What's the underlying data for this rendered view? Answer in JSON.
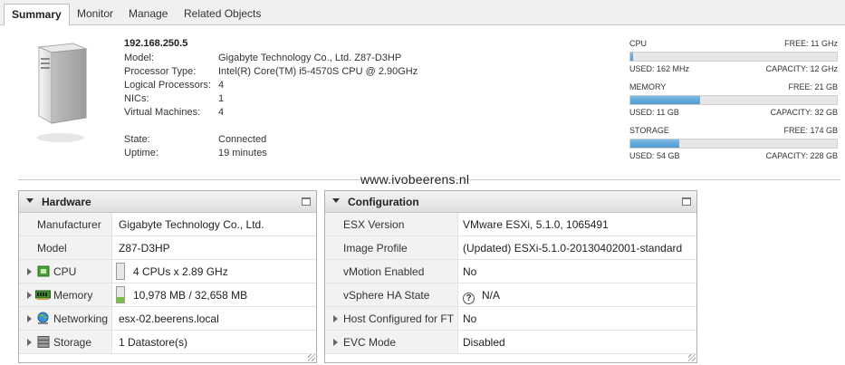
{
  "tabs": [
    {
      "label": "Summary",
      "active": true
    },
    {
      "label": "Monitor",
      "active": false
    },
    {
      "label": "Manage",
      "active": false
    },
    {
      "label": "Related Objects",
      "active": false
    }
  ],
  "host": {
    "name": "192.168.250.5",
    "fields": [
      {
        "label": "Model:",
        "value": "Gigabyte Technology Co., Ltd. Z87-D3HP"
      },
      {
        "label": "Processor Type:",
        "value": "Intel(R) Core(TM) i5-4570S CPU @ 2.90GHz"
      },
      {
        "label": "Logical Processors:",
        "value": "4"
      },
      {
        "label": "NICs:",
        "value": "1"
      },
      {
        "label": "Virtual Machines:",
        "value": "4"
      }
    ],
    "status": [
      {
        "label": "State:",
        "value": "Connected"
      },
      {
        "label": "Uptime:",
        "value": "19 minutes"
      }
    ]
  },
  "resources": [
    {
      "name": "CPU",
      "free": "FREE: 11 GHz",
      "used": "USED: 162 MHz",
      "capacity": "CAPACITY: 12 GHz",
      "fraction": 0.0135
    },
    {
      "name": "MEMORY",
      "free": "FREE: 21 GB",
      "used": "USED: 11 GB",
      "capacity": "CAPACITY: 32 GB",
      "fraction": 0.336
    },
    {
      "name": "STORAGE",
      "free": "FREE: 174 GB",
      "used": "USED: 54 GB",
      "capacity": "CAPACITY: 228 GB",
      "fraction": 0.237
    }
  ],
  "watermark": "www.ivobeerens.nl",
  "hardware": {
    "title": "Hardware",
    "rows": [
      {
        "label": "Manufacturer",
        "value": "Gigabyte Technology Co., Ltd."
      },
      {
        "label": "Model",
        "value": "Z87-D3HP"
      },
      {
        "label": "CPU",
        "value": "4 CPUs x 2.89 GHz",
        "icon": "cpu-icon",
        "usage": 0.0
      },
      {
        "label": "Memory",
        "value": "10,978 MB / 32,658 MB",
        "icon": "memory-icon",
        "usage": 0.336
      },
      {
        "label": "Networking",
        "value": "esx-02.beerens.local",
        "icon": "network-globe-icon"
      },
      {
        "label": "Storage",
        "value": "1 Datastore(s)",
        "icon": "storage-disk-icon"
      }
    ]
  },
  "configuration": {
    "title": "Configuration",
    "rows": [
      {
        "label": "ESX Version",
        "value": "VMware ESXi, 5.1.0, 1065491"
      },
      {
        "label": "Image Profile",
        "value": "(Updated) ESXi-5.1.0-20130402001-standard"
      },
      {
        "label": "vMotion Enabled",
        "value": "No"
      },
      {
        "label": "vSphere HA State",
        "value": "N/A",
        "icon": "question-icon"
      },
      {
        "label": "Host Configured for FT",
        "value": "No"
      },
      {
        "label": "EVC Mode",
        "value": "Disabled"
      }
    ]
  }
}
